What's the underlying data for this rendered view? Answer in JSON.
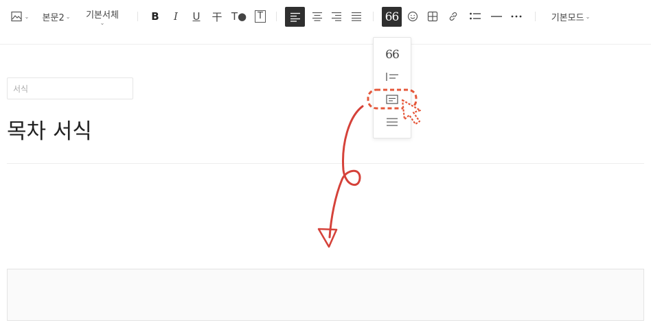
{
  "toolbar": {
    "paragraph_style": "본문2",
    "font_family": "기본서체",
    "bold_label": "B",
    "italic_label": "I",
    "underline_label": "U",
    "strike_label": "干",
    "text_color_label": "T●",
    "text_bg_label": "T",
    "quote_label": "66",
    "mode_label": "기본모드"
  },
  "quote_dropdown": {
    "options": [
      "66",
      "line-quote",
      "box-quote",
      "plain-quote"
    ],
    "first_label": "66",
    "highlighted_index": 2
  },
  "editor": {
    "style_select_value": "서식",
    "title": "목차 서식"
  },
  "colors": {
    "annotation": "#d5423a",
    "annotation_dashed": "#e5573a",
    "active_bg": "#2f2f2f"
  },
  "icons": [
    "image-icon",
    "align-left-icon",
    "align-center-icon",
    "align-right-icon",
    "align-justify-icon",
    "quote-icon",
    "emoji-icon",
    "table-icon",
    "link-icon",
    "list-icon",
    "divider-icon",
    "more-icon",
    "cursor-icon",
    "arrow-icon"
  ]
}
